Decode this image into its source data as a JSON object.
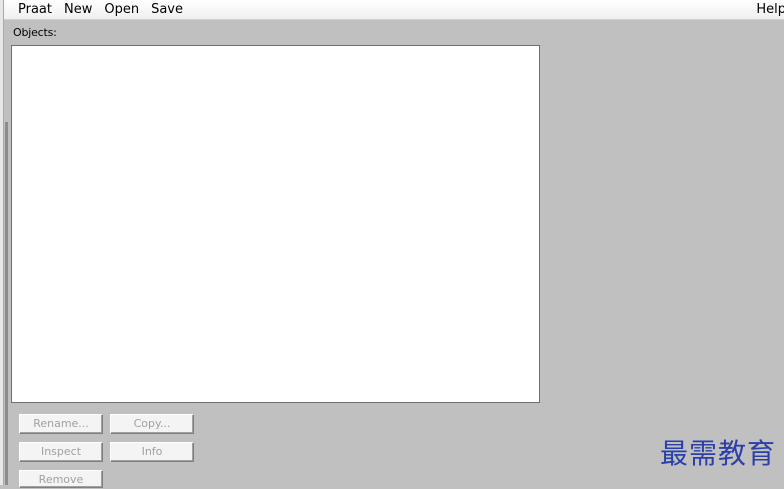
{
  "menubar": {
    "items": [
      {
        "label": "Praat"
      },
      {
        "label": "New"
      },
      {
        "label": "Open"
      },
      {
        "label": "Save"
      }
    ],
    "help_label": "Help"
  },
  "objects": {
    "label": "Objects:",
    "items": []
  },
  "buttons": {
    "rename": "Rename...",
    "copy": "Copy...",
    "inspect": "Inspect",
    "info": "Info",
    "remove": "Remove"
  },
  "watermark": {
    "text": "最需教育"
  }
}
